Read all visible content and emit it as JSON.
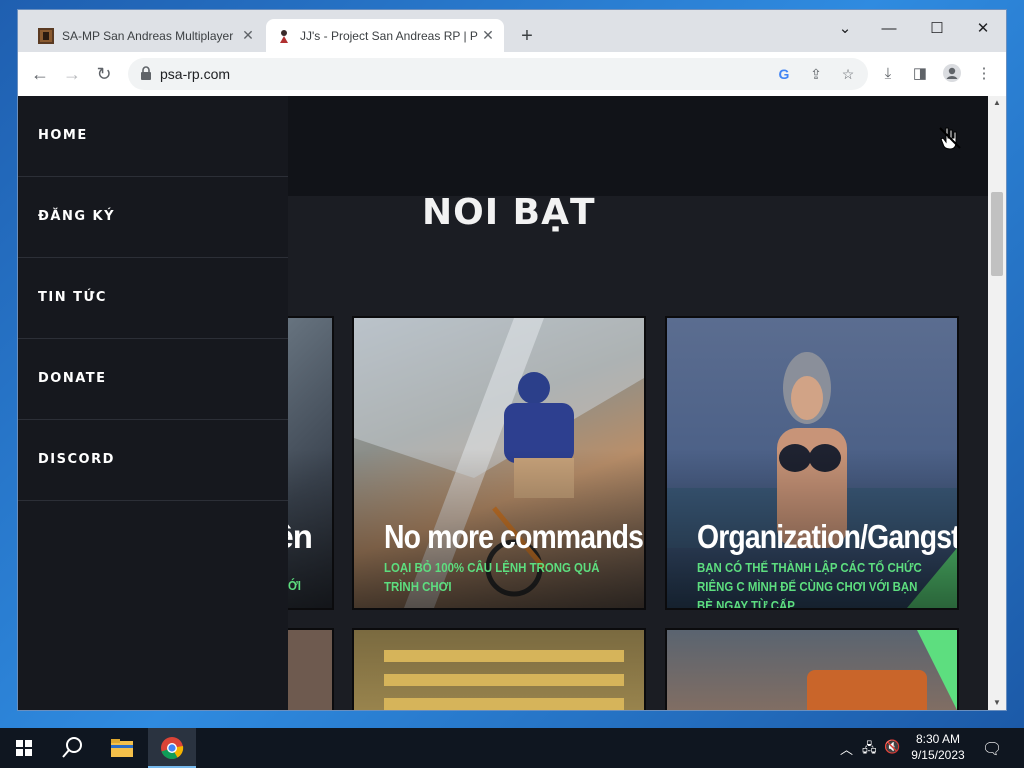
{
  "browser": {
    "tabs": [
      {
        "title": "SA-MP San Andreas Multiplayer",
        "active": false
      },
      {
        "title": "JJ's - Project San Andreas RP | PSA",
        "active": true
      }
    ],
    "new_tab": "+",
    "url": "psa-rp.com",
    "controls": {
      "dropdown": "⌄",
      "minimize": "—",
      "maximize": "☐",
      "close": "✕"
    }
  },
  "site": {
    "nav": [
      "HOME",
      "ĐĂNG KÝ",
      "TIN TỨC",
      "DONATE",
      "DISCORD"
    ],
    "section_title": "NOI BẠT",
    "cards": [
      {
        "title": "yên",
        "desc": "NG VỚI"
      },
      {
        "title": "No more commands",
        "desc": "LOẠI BỎ 100% CÂU LỆNH TRONG QUÁ TRÌNH CHƠI"
      },
      {
        "title": "Organization/Gangst",
        "desc": "BẠN CÓ THỂ THÀNH LẬP CÁC TỔ CHỨC RIÊNG C MÌNH ĐỂ CÙNG CHƠI VỚI BẠN BÈ NGAY TỪ CẤP"
      }
    ],
    "accent_color": "#5dde7f"
  },
  "taskbar": {
    "time": "8:30 AM",
    "date": "9/15/2023"
  }
}
